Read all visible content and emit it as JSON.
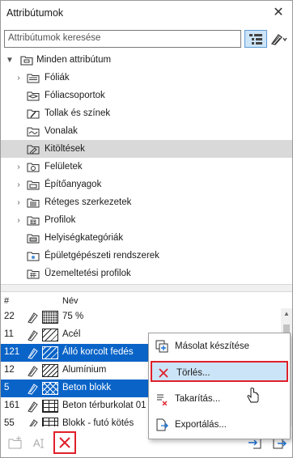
{
  "window": {
    "title": "Attribútumok"
  },
  "search": {
    "placeholder": "Attribútumok keresése"
  },
  "tree": {
    "root": "Minden attribútum",
    "items": [
      {
        "label": "Fóliák",
        "icon": "layers-icon",
        "expandable": true
      },
      {
        "label": "Fóliacsoportok",
        "icon": "layer-combinations-icon",
        "expandable": false
      },
      {
        "label": "Tollak és színek",
        "icon": "pens-colors-icon",
        "expandable": false
      },
      {
        "label": "Vonalak",
        "icon": "line-types-icon",
        "expandable": false
      },
      {
        "label": "Kitöltések",
        "icon": "fills-icon",
        "expandable": false,
        "selected": true
      },
      {
        "label": "Felületek",
        "icon": "surfaces-icon",
        "expandable": true
      },
      {
        "label": "Építőanyagok",
        "icon": "building-materials-icon",
        "expandable": true
      },
      {
        "label": "Réteges szerkezetek",
        "icon": "composites-icon",
        "expandable": true
      },
      {
        "label": "Profilok",
        "icon": "profiles-icon",
        "expandable": true
      },
      {
        "label": "Helyiségkategóriák",
        "icon": "zone-categories-icon",
        "expandable": false
      },
      {
        "label": "Épületgépészeti rendszerek",
        "icon": "mep-systems-icon",
        "expandable": false
      },
      {
        "label": "Üzemeltetési profilok",
        "icon": "operation-profiles-icon",
        "expandable": false
      }
    ]
  },
  "list": {
    "headers": {
      "num": "#",
      "name": "Név"
    },
    "rows": [
      {
        "num": "22",
        "name": "75 %",
        "pattern": "dots",
        "selected": false
      },
      {
        "num": "11",
        "name": "Acél",
        "pattern": "diag",
        "selected": false
      },
      {
        "num": "121",
        "name": "Álló korcolt fedés",
        "pattern": "diag",
        "selected": true
      },
      {
        "num": "12",
        "name": "Alumínium",
        "pattern": "diag",
        "selected": false
      },
      {
        "num": "5",
        "name": "Beton blokk",
        "pattern": "cross",
        "selected": true
      },
      {
        "num": "161",
        "name": "Beton térburkolat 01",
        "pattern": "brick",
        "selected": false
      },
      {
        "num": "55",
        "name": "Blokk - futó kötés",
        "pattern": "brick",
        "selected": false
      }
    ]
  },
  "context_menu": {
    "items": [
      {
        "label": "Másolat készítése",
        "icon": "duplicate-icon"
      },
      {
        "label": "Törlés...",
        "icon": "delete-icon",
        "highlighted": true
      },
      {
        "label": "Takarítás...",
        "icon": "purge-icon"
      },
      {
        "label": "Exportálás...",
        "icon": "export-icon"
      }
    ]
  },
  "colors": {
    "selection": "#0a64c8",
    "highlight": "#cce4f7",
    "accent_red": "#e0202a"
  }
}
